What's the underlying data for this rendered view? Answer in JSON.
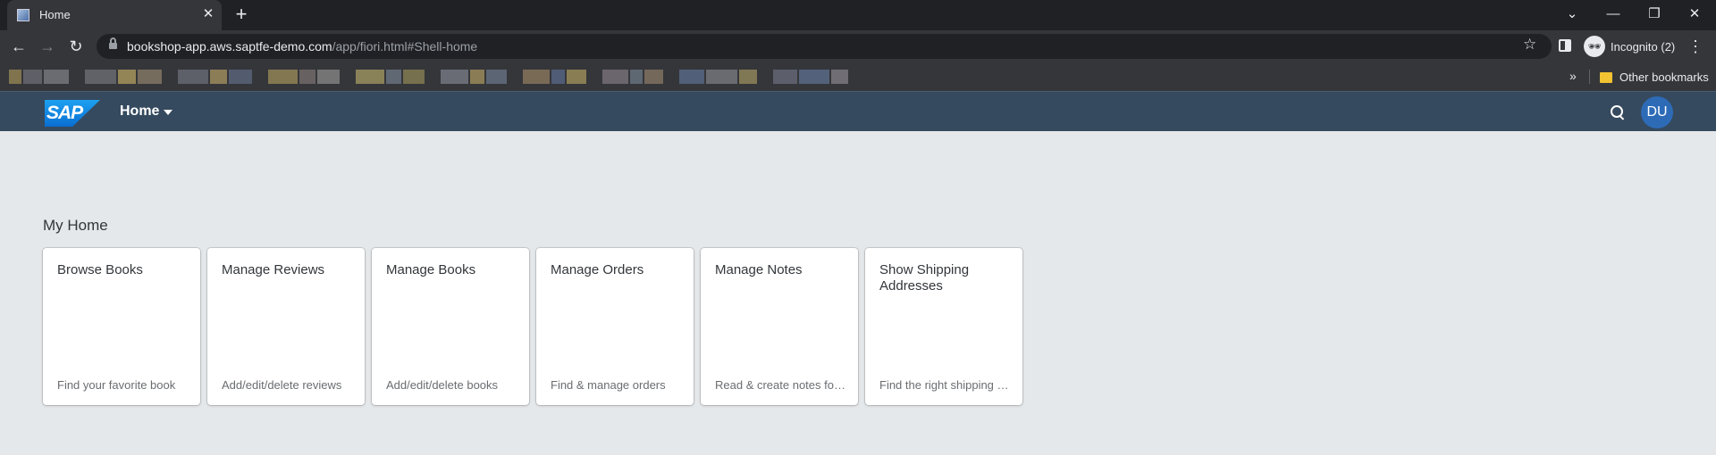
{
  "browser": {
    "tab_title": "Home",
    "tab_close": "✕",
    "new_tab": "+",
    "window_controls": {
      "tab_search": "⌄",
      "minimize": "—",
      "restore": "❐",
      "close": "✕"
    },
    "back": "←",
    "forward": "→",
    "reload": "↻",
    "url_host": "bookshop-app.aws.saptfe-demo.com",
    "url_path": "/app/fiori.html#Shell-home",
    "bookmark_star": "☆",
    "incognito_icon": "🕶",
    "incognito_label": "Incognito (2)",
    "menu": "⋮",
    "bookmarks_chevron": "»",
    "other_bookmarks": "Other bookmarks",
    "bookmark_colors": [
      "#9a8a55",
      "#6e6e78",
      "#7d7e85",
      "#707078",
      "#b4a060",
      "#8c7f6a",
      "#6b6f7a",
      "#a89560",
      "#5d6a80",
      "#9e8e5a",
      "#7a7070",
      "#8a8a8a",
      "#a59b62",
      "#6f7a88",
      "#8c8456",
      "#7b7f8a",
      "#a7945e",
      "#6a7688",
      "#907c60",
      "#5a6a8a",
      "#a6965c",
      "#7e7680",
      "#6c7a86",
      "#8a7a66",
      "#5c6e8e",
      "#7c7c84",
      "#9a8e5e",
      "#6a6e7c",
      "#5e7090",
      "#858088"
    ]
  },
  "shell": {
    "logo_text": "SAP",
    "title": "Home",
    "search_icon": "search-icon",
    "avatar_initials": "DU"
  },
  "main": {
    "section_title": "My Home",
    "tiles": [
      {
        "title": "Browse Books",
        "subtitle": "Find your favorite book"
      },
      {
        "title": "Manage Reviews",
        "subtitle": "Add/edit/delete reviews"
      },
      {
        "title": "Manage Books",
        "subtitle": "Add/edit/delete books"
      },
      {
        "title": "Manage Orders",
        "subtitle": "Find & manage orders"
      },
      {
        "title": "Manage Notes",
        "subtitle": "Read & create notes for orders"
      },
      {
        "title": "Show Shipping Addresses",
        "subtitle": "Find the right shipping address"
      }
    ]
  }
}
